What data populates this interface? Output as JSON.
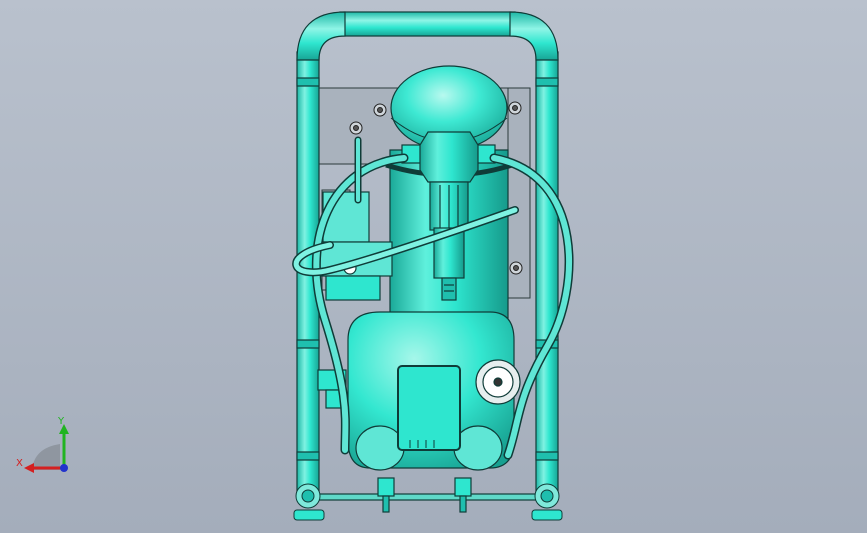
{
  "viewport": {
    "background_top": "#b9c1cd",
    "background_bottom": "#a4adbb"
  },
  "model": {
    "body_color": "#2ee6cf",
    "shade_color": "#1fbfae",
    "highlight_color": "#aef7ec",
    "edge_color": "#0f3c38",
    "panel_color": "#aab3bd"
  },
  "triad": {
    "x_label": "X",
    "y_label": "Y",
    "x_color": "#d42020",
    "y_color": "#21b421",
    "z_color": "#2233cc"
  }
}
